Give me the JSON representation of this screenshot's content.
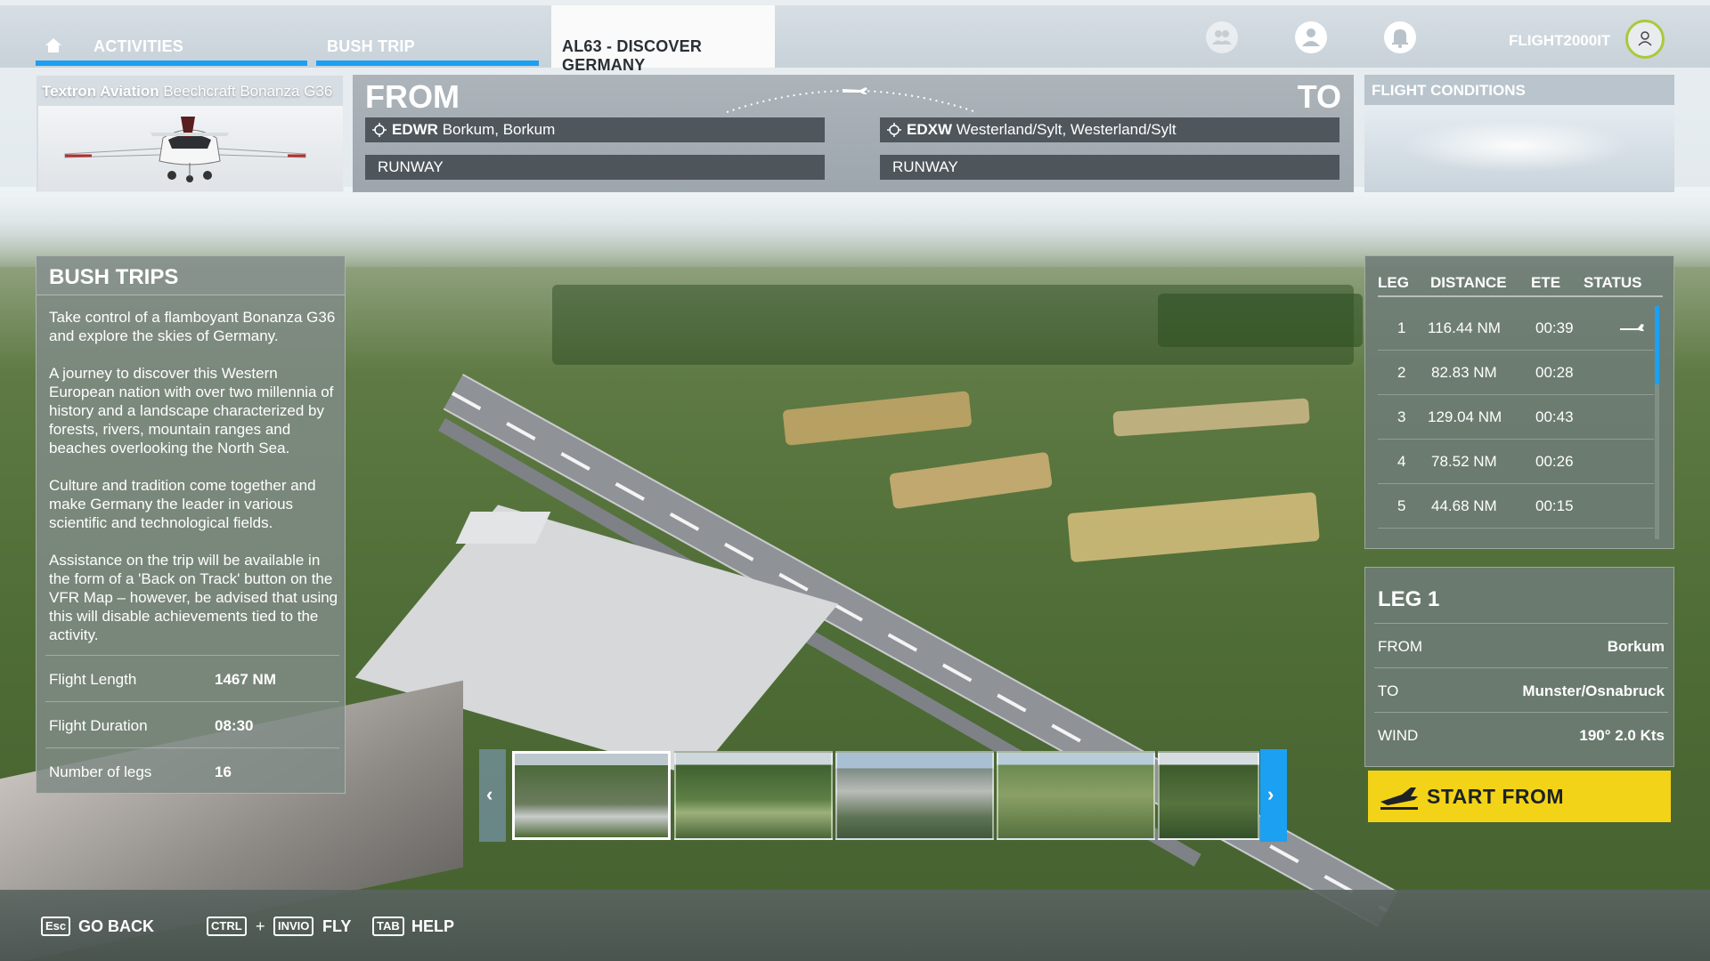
{
  "tabs": {
    "activities": "ACTIVITIES",
    "bush_trip": "BUSH TRIP",
    "current": "AL63 - DISCOVER GERMANY"
  },
  "user": {
    "name": "FLIGHT2000IT"
  },
  "aircraft": {
    "maker": "Textron Aviation",
    "model": "Beechcraft Bonanza G36"
  },
  "route": {
    "from_title": "FROM",
    "to_title": "TO",
    "from_icao": "EDWR",
    "from_name": "Borkum, Borkum",
    "from_runway": "RUNWAY",
    "to_icao": "EDXW",
    "to_name": "Westerland/Sylt, Westerland/Sylt",
    "to_runway": "RUNWAY"
  },
  "conditions": {
    "title": "FLIGHT CONDITIONS"
  },
  "bush": {
    "title": "BUSH TRIPS",
    "paragraphs": [
      "Take control of a flamboyant Bonanza G36 and explore the skies of Germany.",
      "A journey to discover this Western European nation with over two millennia of history and a landscape characterized by forests, rivers, mountain ranges and beaches overlooking the North Sea.",
      "Culture and tradition come together and make Germany the leader in various scientific and technological fields.",
      "Assistance on the trip will be available in the form of a 'Back on Track' button on the VFR Map – however, be advised that using this will disable achievements tied to the activity."
    ],
    "stats": [
      {
        "label": "Flight Length",
        "value": "1467 NM"
      },
      {
        "label": "Flight Duration",
        "value": "08:30"
      },
      {
        "label": "Number of legs",
        "value": "16"
      }
    ]
  },
  "legs": {
    "headers": {
      "leg": "LEG",
      "distance": "DISTANCE",
      "ete": "ETE",
      "status": "STATUS"
    },
    "rows": [
      {
        "leg": "1",
        "distance": "116.44 NM",
        "ete": "00:39",
        "status": "plane-icon"
      },
      {
        "leg": "2",
        "distance": "82.83 NM",
        "ete": "00:28",
        "status": ""
      },
      {
        "leg": "3",
        "distance": "129.04 NM",
        "ete": "00:43",
        "status": ""
      },
      {
        "leg": "4",
        "distance": "78.52 NM",
        "ete": "00:26",
        "status": ""
      },
      {
        "leg": "5",
        "distance": "44.68 NM",
        "ete": "00:15",
        "status": ""
      }
    ]
  },
  "leg_detail": {
    "title": "LEG 1",
    "rows": [
      {
        "label": "FROM",
        "value": "Borkum"
      },
      {
        "label": "TO",
        "value": "Munster/Osnabruck"
      },
      {
        "label": "WIND",
        "value": "190° 2.0 Kts"
      }
    ]
  },
  "start_button": {
    "label": "START FROM"
  },
  "carousel": {
    "prev": "‹",
    "next": "›"
  },
  "bottom": {
    "esc_key": "Esc",
    "go_back": "GO BACK",
    "ctrl_key": "CTRL",
    "plus": "+",
    "invio_key": "INVIO",
    "fly": "FLY",
    "tab_key": "TAB",
    "help": "HELP"
  },
  "colors": {
    "accent": "#1ca0f2",
    "start_button": "#f3d317",
    "avatar_ring": "#a9c93a"
  }
}
